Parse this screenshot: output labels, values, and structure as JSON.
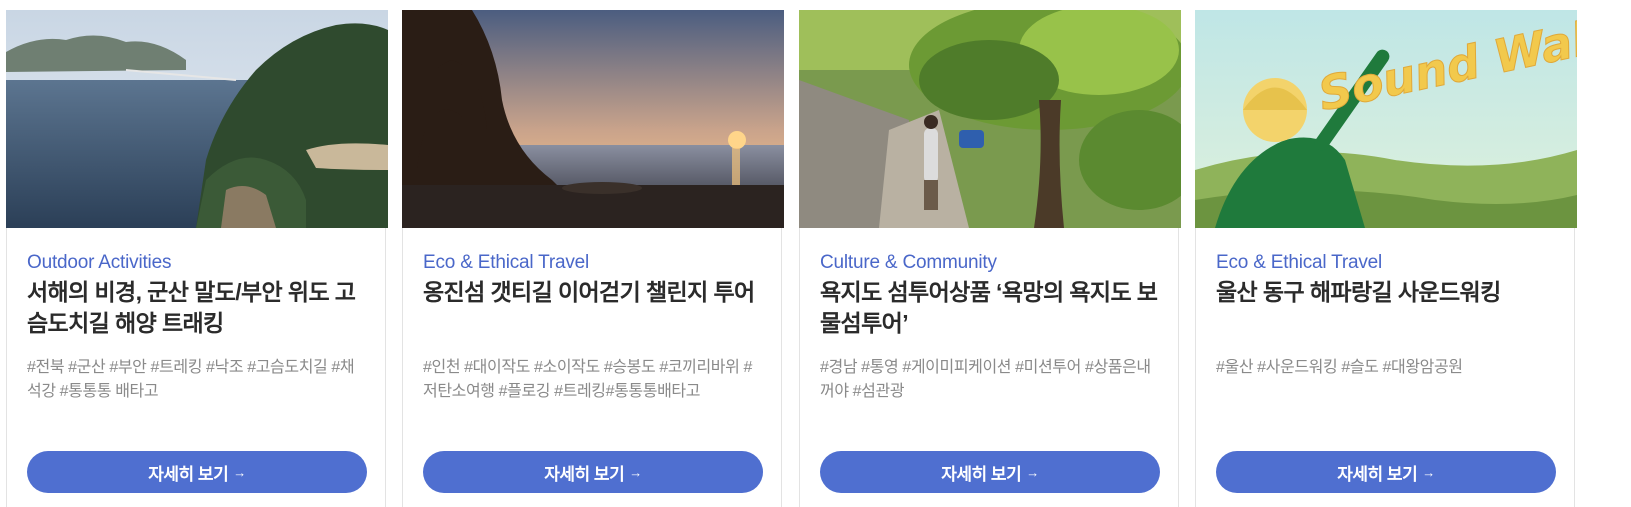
{
  "cards": [
    {
      "category": "Outdoor Activities",
      "title": "서해의 비경, 군산 말도/부안 위도 고슴도치길 해양 트래킹",
      "tags": "#전북 #군산 #부안 #트레킹 #낙조 #고슴도치길 #채석강 #통통통 배타고",
      "button": "자세히 보기",
      "arrow": "→",
      "image_alt": "coastal island landscape"
    },
    {
      "category": "Eco & Ethical Travel",
      "title": "옹진섬 갯티길 이어걷기 챌린지 투어",
      "tags": "#인천 #대이작도 #소이작도 #승봉도 #코끼리바위 #저탄소여행 #플로깅 #트레킹#통통통배타고",
      "button": "자세히 보기",
      "arrow": "→",
      "image_alt": "sea arch at sunset"
    },
    {
      "category": "Culture & Community",
      "title": "욕지도 섬투어상품 ‘욕망의 욕지도 보물섬투어’",
      "tags": "#경남 #통영 #게이미피케이션 #미션투어 #상품은내꺼야 #섬관광",
      "button": "자세히 보기",
      "arrow": "→",
      "image_alt": "village path with large tree"
    },
    {
      "category": "Eco & Ethical Travel",
      "title": "울산 동구 해파랑길 사운드워킹",
      "tags": "#울산 #사운드워킹 #슬도 #대왕암공원",
      "button": "자세히 보기",
      "arrow": "→",
      "image_alt": "Sound Walking illustration",
      "image_text": "Sound Walking"
    }
  ],
  "colors": {
    "accent": "#4a67c9",
    "button": "#4f6fd0",
    "title": "#2b2b2b",
    "tags": "#8a8a8a"
  }
}
